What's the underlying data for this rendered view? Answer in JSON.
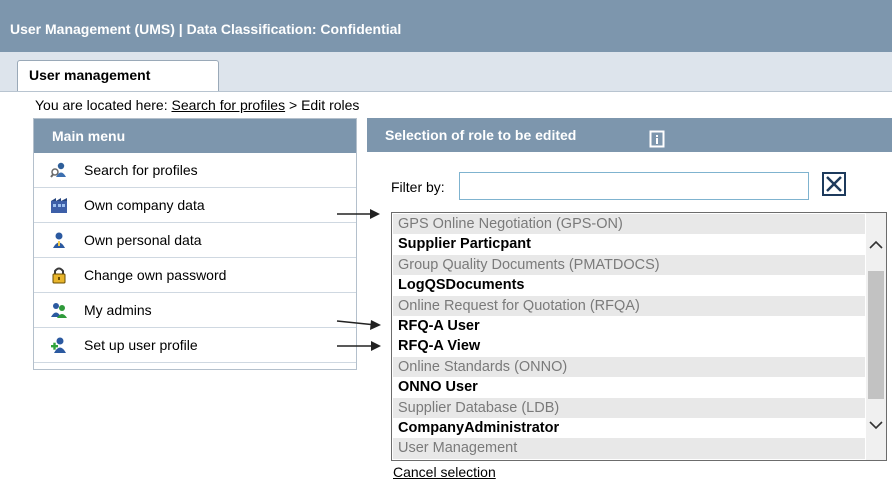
{
  "window": {
    "title": "User Management (UMS) | Data Classification: Confidential"
  },
  "tabs": [
    {
      "label": "User management",
      "active": true
    }
  ],
  "breadcrumb": {
    "prefix": "You are located here:",
    "link": "Search for profiles",
    "separator": ">",
    "current": "Edit roles"
  },
  "main_menu": {
    "header": "Main menu",
    "items": [
      {
        "label": "Search for profiles",
        "icon": "search-person-icon"
      },
      {
        "label": "Own company data",
        "icon": "company-icon"
      },
      {
        "label": "Own personal data",
        "icon": "person-icon"
      },
      {
        "label": "Change own password",
        "icon": "padlock-icon"
      },
      {
        "label": "My admins",
        "icon": "admins-icon"
      },
      {
        "label": "Set up user profile",
        "icon": "add-user-icon"
      }
    ]
  },
  "role_panel": {
    "header": "Selection of role to be edited",
    "header_icon": "document-icon",
    "filter_label": "Filter by:",
    "filter_value": "",
    "clear_icon": "close-x-icon",
    "list_rows": [
      {
        "text": "GPS Online Negotiation (GPS-ON)",
        "kind": "group"
      },
      {
        "text": "Supplier Particpant",
        "kind": "role"
      },
      {
        "text": "Group Quality Documents (PMATDOCS)",
        "kind": "group"
      },
      {
        "text": "LogQSDocuments",
        "kind": "role"
      },
      {
        "text": "Online Request for Quotation (RFQA)",
        "kind": "group"
      },
      {
        "text": "RFQ-A User",
        "kind": "role"
      },
      {
        "text": "RFQ-A View",
        "kind": "role"
      },
      {
        "text": "Online Standards (ONNO)",
        "kind": "group"
      },
      {
        "text": "ONNO User",
        "kind": "role"
      },
      {
        "text": "Supplier Database (LDB)",
        "kind": "group"
      },
      {
        "text": "CompanyAdministrator",
        "kind": "role"
      },
      {
        "text": "User Management",
        "kind": "group"
      }
    ],
    "cancel_label": "Cancel selection"
  },
  "colors": {
    "header_bar": "#7d96ad",
    "tab_strip": "#dde4ec",
    "group_row": "#e8e8e8"
  }
}
